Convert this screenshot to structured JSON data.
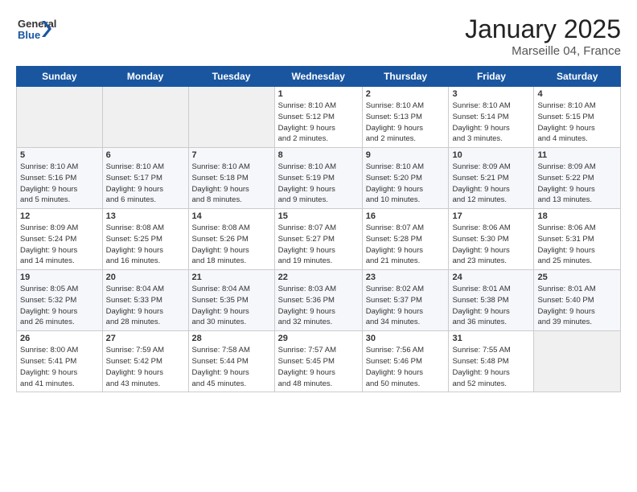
{
  "logo": {
    "text_general": "General",
    "text_blue": "Blue"
  },
  "title": "January 2025",
  "location": "Marseille 04, France",
  "weekdays": [
    "Sunday",
    "Monday",
    "Tuesday",
    "Wednesday",
    "Thursday",
    "Friday",
    "Saturday"
  ],
  "weeks": [
    [
      {
        "day": "",
        "info": ""
      },
      {
        "day": "",
        "info": ""
      },
      {
        "day": "",
        "info": ""
      },
      {
        "day": "1",
        "info": "Sunrise: 8:10 AM\nSunset: 5:12 PM\nDaylight: 9 hours\nand 2 minutes."
      },
      {
        "day": "2",
        "info": "Sunrise: 8:10 AM\nSunset: 5:13 PM\nDaylight: 9 hours\nand 2 minutes."
      },
      {
        "day": "3",
        "info": "Sunrise: 8:10 AM\nSunset: 5:14 PM\nDaylight: 9 hours\nand 3 minutes."
      },
      {
        "day": "4",
        "info": "Sunrise: 8:10 AM\nSunset: 5:15 PM\nDaylight: 9 hours\nand 4 minutes."
      }
    ],
    [
      {
        "day": "5",
        "info": "Sunrise: 8:10 AM\nSunset: 5:16 PM\nDaylight: 9 hours\nand 5 minutes."
      },
      {
        "day": "6",
        "info": "Sunrise: 8:10 AM\nSunset: 5:17 PM\nDaylight: 9 hours\nand 6 minutes."
      },
      {
        "day": "7",
        "info": "Sunrise: 8:10 AM\nSunset: 5:18 PM\nDaylight: 9 hours\nand 8 minutes."
      },
      {
        "day": "8",
        "info": "Sunrise: 8:10 AM\nSunset: 5:19 PM\nDaylight: 9 hours\nand 9 minutes."
      },
      {
        "day": "9",
        "info": "Sunrise: 8:10 AM\nSunset: 5:20 PM\nDaylight: 9 hours\nand 10 minutes."
      },
      {
        "day": "10",
        "info": "Sunrise: 8:09 AM\nSunset: 5:21 PM\nDaylight: 9 hours\nand 12 minutes."
      },
      {
        "day": "11",
        "info": "Sunrise: 8:09 AM\nSunset: 5:22 PM\nDaylight: 9 hours\nand 13 minutes."
      }
    ],
    [
      {
        "day": "12",
        "info": "Sunrise: 8:09 AM\nSunset: 5:24 PM\nDaylight: 9 hours\nand 14 minutes."
      },
      {
        "day": "13",
        "info": "Sunrise: 8:08 AM\nSunset: 5:25 PM\nDaylight: 9 hours\nand 16 minutes."
      },
      {
        "day": "14",
        "info": "Sunrise: 8:08 AM\nSunset: 5:26 PM\nDaylight: 9 hours\nand 18 minutes."
      },
      {
        "day": "15",
        "info": "Sunrise: 8:07 AM\nSunset: 5:27 PM\nDaylight: 9 hours\nand 19 minutes."
      },
      {
        "day": "16",
        "info": "Sunrise: 8:07 AM\nSunset: 5:28 PM\nDaylight: 9 hours\nand 21 minutes."
      },
      {
        "day": "17",
        "info": "Sunrise: 8:06 AM\nSunset: 5:30 PM\nDaylight: 9 hours\nand 23 minutes."
      },
      {
        "day": "18",
        "info": "Sunrise: 8:06 AM\nSunset: 5:31 PM\nDaylight: 9 hours\nand 25 minutes."
      }
    ],
    [
      {
        "day": "19",
        "info": "Sunrise: 8:05 AM\nSunset: 5:32 PM\nDaylight: 9 hours\nand 26 minutes."
      },
      {
        "day": "20",
        "info": "Sunrise: 8:04 AM\nSunset: 5:33 PM\nDaylight: 9 hours\nand 28 minutes."
      },
      {
        "day": "21",
        "info": "Sunrise: 8:04 AM\nSunset: 5:35 PM\nDaylight: 9 hours\nand 30 minutes."
      },
      {
        "day": "22",
        "info": "Sunrise: 8:03 AM\nSunset: 5:36 PM\nDaylight: 9 hours\nand 32 minutes."
      },
      {
        "day": "23",
        "info": "Sunrise: 8:02 AM\nSunset: 5:37 PM\nDaylight: 9 hours\nand 34 minutes."
      },
      {
        "day": "24",
        "info": "Sunrise: 8:01 AM\nSunset: 5:38 PM\nDaylight: 9 hours\nand 36 minutes."
      },
      {
        "day": "25",
        "info": "Sunrise: 8:01 AM\nSunset: 5:40 PM\nDaylight: 9 hours\nand 39 minutes."
      }
    ],
    [
      {
        "day": "26",
        "info": "Sunrise: 8:00 AM\nSunset: 5:41 PM\nDaylight: 9 hours\nand 41 minutes."
      },
      {
        "day": "27",
        "info": "Sunrise: 7:59 AM\nSunset: 5:42 PM\nDaylight: 9 hours\nand 43 minutes."
      },
      {
        "day": "28",
        "info": "Sunrise: 7:58 AM\nSunset: 5:44 PM\nDaylight: 9 hours\nand 45 minutes."
      },
      {
        "day": "29",
        "info": "Sunrise: 7:57 AM\nSunset: 5:45 PM\nDaylight: 9 hours\nand 48 minutes."
      },
      {
        "day": "30",
        "info": "Sunrise: 7:56 AM\nSunset: 5:46 PM\nDaylight: 9 hours\nand 50 minutes."
      },
      {
        "day": "31",
        "info": "Sunrise: 7:55 AM\nSunset: 5:48 PM\nDaylight: 9 hours\nand 52 minutes."
      },
      {
        "day": "",
        "info": ""
      }
    ]
  ]
}
